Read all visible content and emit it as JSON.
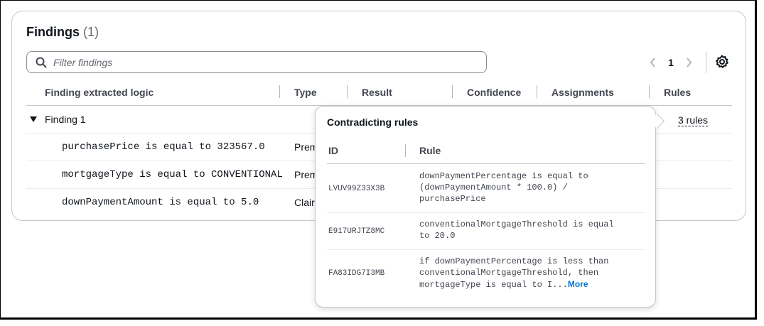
{
  "findings": {
    "title": "Findings",
    "count": "(1)",
    "search_placeholder": "Filter findings",
    "page": "1",
    "columns": [
      "Finding extracted logic",
      "Type",
      "Result",
      "Confidence",
      "Assignments",
      "Rules"
    ],
    "group": {
      "label": "Finding 1",
      "rules_link": "3 rules"
    },
    "rows": [
      {
        "logic": "purchasePrice is equal to 323567.0",
        "type": "Prem"
      },
      {
        "logic": "mortgageType is equal to CONVENTIONAL",
        "type": "Prem"
      },
      {
        "logic": "downPaymentAmount is equal to 5.0",
        "type": "Clair"
      }
    ]
  },
  "popover": {
    "title": "Contradicting rules",
    "col_id": "ID",
    "col_rule": "Rule",
    "rules": [
      {
        "id": "LVUV99Z33X3B",
        "rule": "downPaymentPercentage is equal to\n(downPaymentAmount * 100.0) /\npurchasePrice"
      },
      {
        "id": "E917URJTZ8MC",
        "rule": "conventionalMortgageThreshold is equal\nto 20.0"
      },
      {
        "id": "FA83IDG7I3MB",
        "rule": "if downPaymentPercentage is less than\nconventionalMortgageThreshold, then\nmortgageType is equal to I...",
        "more": "More"
      }
    ]
  },
  "icons": {
    "search": "search-icon",
    "prev": "chevron-left-icon",
    "next": "chevron-right-icon",
    "settings": "gear-icon",
    "expand": "caret-down-icon"
  },
  "colors": {
    "link": "#0972d3",
    "border": "#c6c6cd",
    "text": "#0f141a"
  }
}
